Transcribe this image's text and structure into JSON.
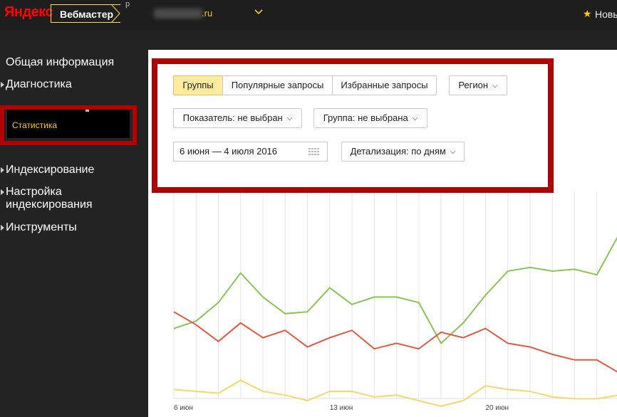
{
  "header": {
    "logo_text": "Яндекс",
    "product_label": "Вебмастер",
    "product_sup": "р",
    "site_domain": ".ru",
    "new_label": "Новы"
  },
  "sidebar": {
    "items": [
      {
        "label": "Общая информация"
      },
      {
        "label": "Диагностика"
      },
      {
        "label": "Индексирование"
      },
      {
        "label": "Настройка индексирования"
      },
      {
        "label": "Инструменты"
      }
    ],
    "active_sub": "Статистика"
  },
  "filters": {
    "tabs": [
      "Группы",
      "Популярные запросы",
      "Избранные запросы"
    ],
    "active_tab": 0,
    "region_label": "Регион",
    "metric_label": "Показатель: не выбран",
    "group_label": "Группа: не выбрана",
    "date_range": "6 июня — 4 июля 2016",
    "detail_label": "Детализация: по дням"
  },
  "colors": {
    "green": "#8cc455",
    "red": "#e05a44",
    "yellow": "#f5d86a",
    "accent_frame": "#b20000"
  },
  "chart_data": {
    "type": "line",
    "x": [
      "6 июн",
      "7 июн",
      "8 июн",
      "9 июн",
      "10 июн",
      "11 июн",
      "12 июн",
      "13 июн",
      "14 июн",
      "15 июн",
      "16 июн",
      "17 июн",
      "18 июн",
      "19 июн",
      "20 июн",
      "21 июн",
      "22 июн",
      "23 июн",
      "24 июн",
      "25 июн",
      "26 июн"
    ],
    "x_tick_labels": [
      "6 июн",
      "13 июн",
      "20 июн"
    ],
    "series": [
      {
        "color": "green",
        "values": [
          34,
          38,
          48,
          64,
          51,
          42,
          43,
          56,
          47,
          51,
          51,
          48,
          26,
          37,
          52,
          65,
          67,
          65,
          66,
          63,
          85
        ]
      },
      {
        "color": "red",
        "values": [
          43,
          36,
          27,
          37,
          29,
          33,
          24,
          29,
          33,
          23,
          26,
          23,
          32,
          29,
          34,
          26,
          24,
          20,
          17,
          17,
          10
        ]
      },
      {
        "color": "yellow",
        "values": [
          1,
          0,
          -1,
          6,
          0,
          -2,
          -5,
          0,
          0,
          -3,
          -2,
          -5,
          -8,
          -5,
          3,
          1,
          0,
          -3,
          -4,
          -4,
          -2
        ]
      }
    ]
  }
}
